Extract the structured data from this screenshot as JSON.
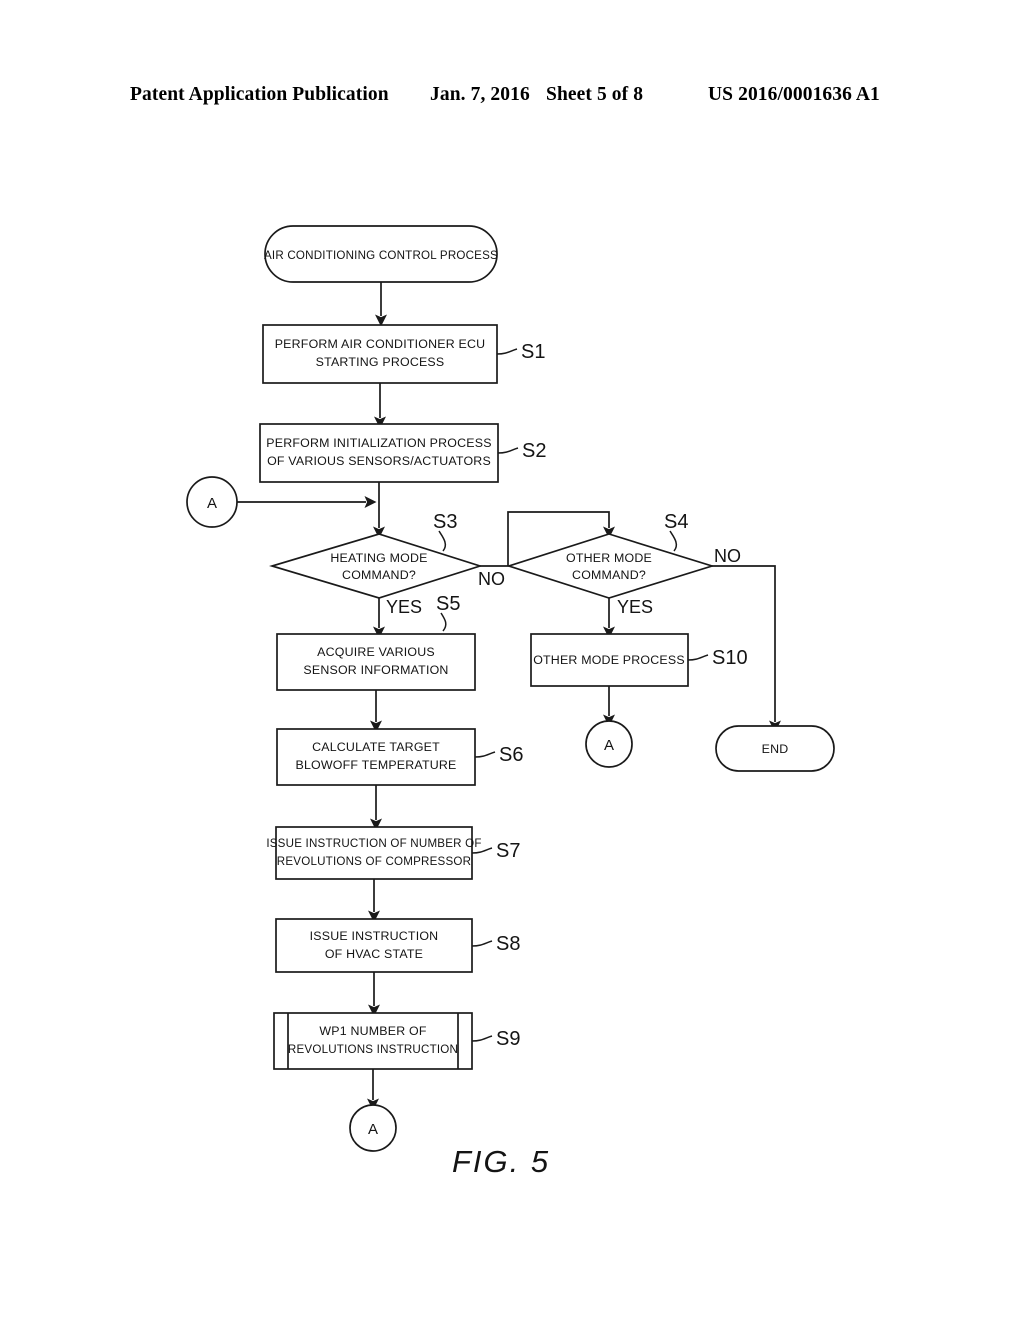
{
  "header": {
    "title": "Patent Application Publication",
    "date": "Jan. 7, 2016",
    "sheet": "Sheet 5 of 8",
    "patent_number": "US 2016/0001636 A1"
  },
  "figure": {
    "caption": "FIG. 5",
    "nodes": {
      "start": {
        "label": "AIR CONDITIONING CONTROL PROCESS",
        "shape": "terminal"
      },
      "s1": {
        "line1": "PERFORM AIR CONDITIONER ECU",
        "line2": "STARTING PROCESS",
        "step": "S1",
        "shape": "process"
      },
      "s2": {
        "line1": "PERFORM INITIALIZATION PROCESS",
        "line2": "OF VARIOUS SENSORS/ACTUATORS",
        "step": "S2",
        "shape": "process"
      },
      "s3": {
        "line1": "HEATING MODE",
        "line2": "COMMAND?",
        "step": "S3",
        "shape": "decision",
        "yes": "YES",
        "no": "NO"
      },
      "s4": {
        "line1": "OTHER MODE",
        "line2": "COMMAND?",
        "step": "S4",
        "shape": "decision",
        "yes": "YES",
        "no": "NO"
      },
      "s5": {
        "line1": "ACQUIRE VARIOUS",
        "line2": "SENSOR INFORMATION",
        "step": "S5",
        "shape": "process"
      },
      "s6": {
        "line1": "CALCULATE TARGET",
        "line2": "BLOWOFF TEMPERATURE",
        "step": "S6",
        "shape": "process"
      },
      "s7": {
        "line1": "ISSUE INSTRUCTION OF NUMBER OF",
        "line2": "REVOLUTIONS OF COMPRESSOR",
        "step": "S7",
        "shape": "process"
      },
      "s8": {
        "line1": "ISSUE INSTRUCTION",
        "line2": "OF HVAC STATE",
        "step": "S8",
        "shape": "process"
      },
      "s9": {
        "line1": "WP1 NUMBER OF",
        "line2": "REVOLUTIONS INSTRUCTION",
        "step": "S9",
        "shape": "predefined-process"
      },
      "s10": {
        "label": "OTHER MODE PROCESS",
        "step": "S10",
        "shape": "process"
      },
      "end": {
        "label": "END",
        "shape": "terminal"
      },
      "connector_left": {
        "label": "A",
        "shape": "connector"
      },
      "connector_middle": {
        "label": "A",
        "shape": "connector"
      },
      "connector_bottom": {
        "label": "A",
        "shape": "connector"
      }
    }
  },
  "colors": {
    "ink": "#1a1a1a",
    "paper": "#ffffff"
  }
}
